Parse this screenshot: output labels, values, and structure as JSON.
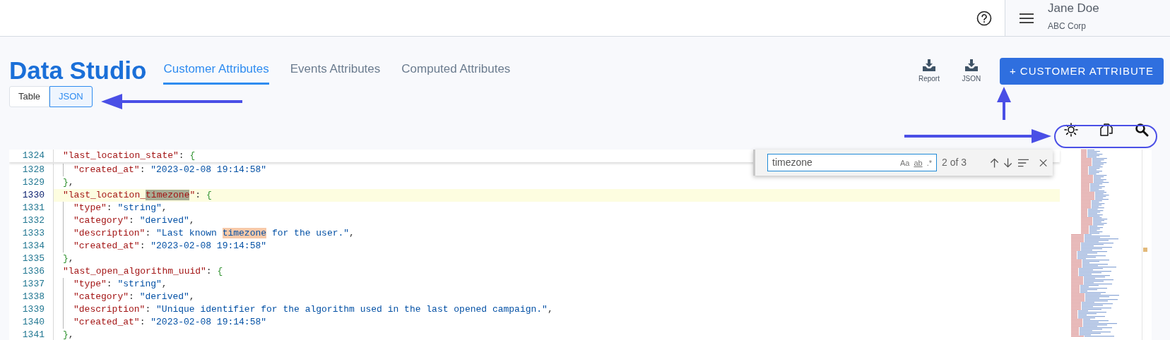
{
  "header": {
    "user_name": "Jane Doe",
    "company": "ABC Corp"
  },
  "title": "Data Studio",
  "tabs": [
    {
      "label": "Customer Attributes",
      "selected": true
    },
    {
      "label": "Events Attributes",
      "selected": false
    },
    {
      "label": "Computed Attributes",
      "selected": false
    }
  ],
  "view_toggle": [
    {
      "label": "Table",
      "selected": false
    },
    {
      "label": "JSON",
      "selected": true
    }
  ],
  "downloads": [
    {
      "label": "Report"
    },
    {
      "label": "JSON"
    }
  ],
  "primary_button": "+ CUSTOMER ATTRIBUTE",
  "find_widget": {
    "value": "timezone",
    "options": [
      "Aa",
      "ab",
      ".*"
    ],
    "match_count": "2 of 3"
  },
  "sticky_line": {
    "number": "1324",
    "inner": false,
    "current": false,
    "tokens": [
      {
        "text": "\"last_location_state\"",
        "kind": "key"
      },
      {
        "text": ": ",
        "kind": "punct"
      },
      {
        "text": "{",
        "kind": "brace"
      }
    ]
  },
  "lines": [
    {
      "number": "1328",
      "inner": true,
      "current": false,
      "tokens": [
        {
          "text": "\"created_at\"",
          "kind": "key"
        },
        {
          "text": ": ",
          "kind": "punct"
        },
        {
          "text": "\"2023-02-08 19:14:58\"",
          "kind": "string"
        }
      ]
    },
    {
      "number": "1329",
      "inner": false,
      "current": false,
      "tokens": [
        {
          "text": "}",
          "kind": "brace"
        },
        {
          "text": ",",
          "kind": "punct"
        }
      ]
    },
    {
      "number": "1330",
      "inner": false,
      "current": true,
      "tokens": [
        {
          "text": "\"last_location_",
          "kind": "key"
        },
        {
          "text": "timezone",
          "kind": "key",
          "match": true,
          "active": true
        },
        {
          "text": "\"",
          "kind": "key"
        },
        {
          "text": ": ",
          "kind": "punct"
        },
        {
          "text": "{",
          "kind": "brace"
        }
      ]
    },
    {
      "number": "1331",
      "inner": true,
      "current": false,
      "tokens": [
        {
          "text": "\"type\"",
          "kind": "key"
        },
        {
          "text": ": ",
          "kind": "punct"
        },
        {
          "text": "\"string\"",
          "kind": "string"
        },
        {
          "text": ",",
          "kind": "punct"
        }
      ]
    },
    {
      "number": "1332",
      "inner": true,
      "current": false,
      "tokens": [
        {
          "text": "\"category\"",
          "kind": "key"
        },
        {
          "text": ": ",
          "kind": "punct"
        },
        {
          "text": "\"derived\"",
          "kind": "string"
        },
        {
          "text": ",",
          "kind": "punct"
        }
      ]
    },
    {
      "number": "1333",
      "inner": true,
      "current": false,
      "tokens": [
        {
          "text": "\"description\"",
          "kind": "key"
        },
        {
          "text": ": ",
          "kind": "punct"
        },
        {
          "text": "\"Last known ",
          "kind": "string"
        },
        {
          "text": "timezone",
          "kind": "string",
          "match": true,
          "active": false
        },
        {
          "text": " for the user.\"",
          "kind": "string"
        },
        {
          "text": ",",
          "kind": "punct"
        }
      ]
    },
    {
      "number": "1334",
      "inner": true,
      "current": false,
      "tokens": [
        {
          "text": "\"created_at\"",
          "kind": "key"
        },
        {
          "text": ": ",
          "kind": "punct"
        },
        {
          "text": "\"2023-02-08 19:14:58\"",
          "kind": "string"
        }
      ]
    },
    {
      "number": "1335",
      "inner": false,
      "current": false,
      "tokens": [
        {
          "text": "}",
          "kind": "brace"
        },
        {
          "text": ",",
          "kind": "punct"
        }
      ]
    },
    {
      "number": "1336",
      "inner": false,
      "current": false,
      "tokens": [
        {
          "text": "\"last_open_algorithm_uuid\"",
          "kind": "key"
        },
        {
          "text": ": ",
          "kind": "punct"
        },
        {
          "text": "{",
          "kind": "brace"
        }
      ]
    },
    {
      "number": "1337",
      "inner": true,
      "current": false,
      "tokens": [
        {
          "text": "\"type\"",
          "kind": "key"
        },
        {
          "text": ": ",
          "kind": "punct"
        },
        {
          "text": "\"string\"",
          "kind": "string"
        },
        {
          "text": ",",
          "kind": "punct"
        }
      ]
    },
    {
      "number": "1338",
      "inner": true,
      "current": false,
      "tokens": [
        {
          "text": "\"category\"",
          "kind": "key"
        },
        {
          "text": ": ",
          "kind": "punct"
        },
        {
          "text": "\"derived\"",
          "kind": "string"
        },
        {
          "text": ",",
          "kind": "punct"
        }
      ]
    },
    {
      "number": "1339",
      "inner": true,
      "current": false,
      "tokens": [
        {
          "text": "\"description\"",
          "kind": "key"
        },
        {
          "text": ": ",
          "kind": "punct"
        },
        {
          "text": "\"Unique identifier for the algorithm used in the last opened campaign.\"",
          "kind": "string"
        },
        {
          "text": ",",
          "kind": "punct"
        }
      ]
    },
    {
      "number": "1340",
      "inner": true,
      "current": false,
      "tokens": [
        {
          "text": "\"created_at\"",
          "kind": "key"
        },
        {
          "text": ": ",
          "kind": "punct"
        },
        {
          "text": "\"2023-02-08 19:14:58\"",
          "kind": "string"
        }
      ]
    },
    {
      "number": "1341",
      "inner": false,
      "current": false,
      "tokens": [
        {
          "text": "}",
          "kind": "brace"
        },
        {
          "text": ",",
          "kind": "punct"
        }
      ]
    }
  ]
}
